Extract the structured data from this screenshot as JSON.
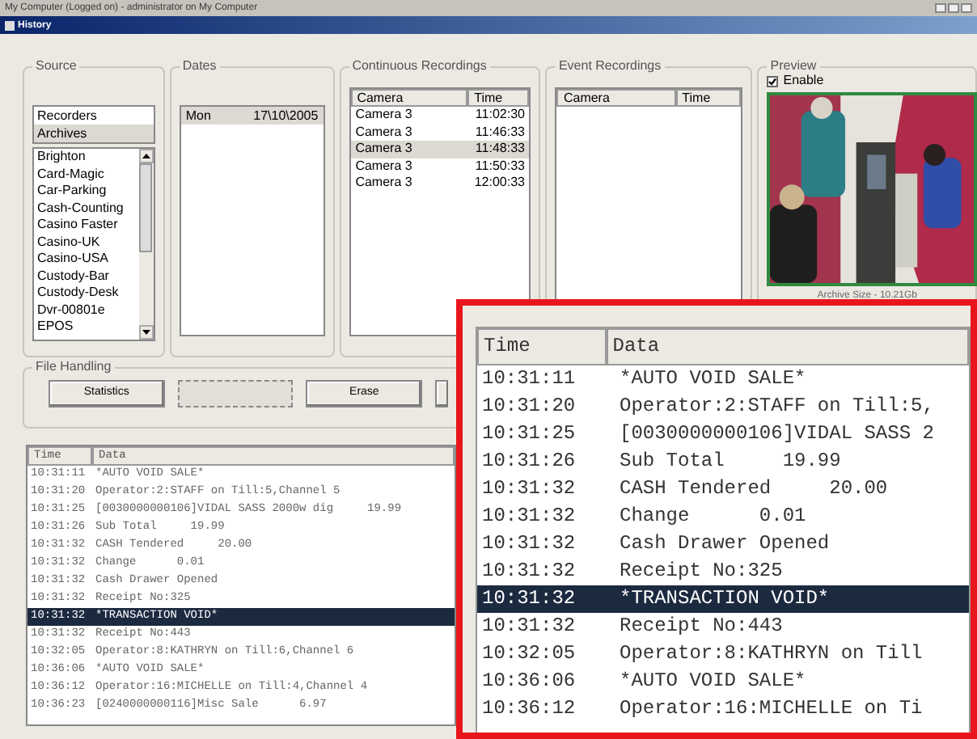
{
  "title_bar": {
    "title": "My Computer (Logged on) - administrator on My Computer"
  },
  "window": {
    "title": "History"
  },
  "source": {
    "label": "Source",
    "modes": [
      {
        "label": "Recorders",
        "selected": false
      },
      {
        "label": "Archives",
        "selected": true
      }
    ],
    "archives": [
      "Brighton",
      "Card-Magic",
      "Car-Parking",
      "Cash-Counting",
      "Casino Faster",
      "Casino-UK",
      "Casino-USA",
      "Custody-Bar",
      "Custody-Desk",
      "Dvr-00801e",
      "EPOS"
    ]
  },
  "dates": {
    "label": "Dates",
    "rows": [
      {
        "day": "Mon",
        "date": "17\\10\\2005",
        "selected": true
      }
    ]
  },
  "continuous": {
    "label": "Continuous Recordings",
    "columns": [
      "Camera",
      "Time"
    ],
    "rows": [
      {
        "camera": "Camera 3",
        "time": "11:02:30",
        "selected": false
      },
      {
        "camera": "Camera 3",
        "time": "11:46:33",
        "selected": false
      },
      {
        "camera": "Camera 3",
        "time": "11:48:33",
        "selected": true
      },
      {
        "camera": "Camera 3",
        "time": "11:50:33",
        "selected": false
      },
      {
        "camera": "Camera 3",
        "time": "12:00:33",
        "selected": false
      }
    ]
  },
  "event": {
    "label": "Event Recordings",
    "columns": [
      "Camera",
      "Time"
    ]
  },
  "preview": {
    "label": "Preview",
    "enable": {
      "label": "Enable",
      "checked": true
    },
    "archive_size": "Archive Size - 10.21Gb"
  },
  "file_handling": {
    "label": "File Handling",
    "buttons": [
      {
        "label": "Statistics",
        "disabled": false
      },
      {
        "disabled": true
      },
      {
        "label": "Erase",
        "disabled": false
      },
      {
        "disabled": false
      }
    ]
  },
  "log": {
    "columns": [
      "Time",
      "Data"
    ],
    "rows": [
      {
        "time": "10:31:11",
        "data": "*AUTO VOID SALE*",
        "selected": false
      },
      {
        "time": "10:31:20",
        "data": "Operator:2:STAFF on Till:5,Channel 5",
        "selected": false
      },
      {
        "time": "10:31:25",
        "data": "[0030000000106]VIDAL SASS 2000w dig     19.99",
        "selected": false
      },
      {
        "time": "10:31:26",
        "data": "Sub Total     19.99",
        "selected": false
      },
      {
        "time": "10:31:32",
        "data": "CASH Tendered     20.00",
        "selected": false
      },
      {
        "time": "10:31:32",
        "data": "Change      0.01",
        "selected": false
      },
      {
        "time": "10:31:32",
        "data": "Cash Drawer Opened",
        "selected": false
      },
      {
        "time": "10:31:32",
        "data": "Receipt No:325",
        "selected": false
      },
      {
        "time": "10:31:32",
        "data": "*TRANSACTION VOID*",
        "selected": true
      },
      {
        "time": "10:31:32",
        "data": "Receipt No:443",
        "selected": false
      },
      {
        "time": "10:32:05",
        "data": "Operator:8:KATHRYN on Till:6,Channel 6",
        "selected": false
      },
      {
        "time": "10:36:06",
        "data": "*AUTO VOID SALE*",
        "selected": false
      },
      {
        "time": "10:36:12",
        "data": "Operator:16:MICHELLE on Till:4,Channel 4",
        "selected": false
      },
      {
        "time": "10:36:23",
        "data": "[0240000000116]Misc Sale      6.97",
        "selected": false
      }
    ]
  },
  "zoom_inset": {
    "columns": [
      "Time",
      "Data"
    ],
    "rows": [
      {
        "time": "10:31:11",
        "data": "*AUTO VOID SALE*",
        "selected": false
      },
      {
        "time": "10:31:20",
        "data": "Operator:2:STAFF on Till:5,",
        "selected": false
      },
      {
        "time": "10:31:25",
        "data": "[0030000000106]VIDAL SASS 2",
        "selected": false
      },
      {
        "time": "10:31:26",
        "data": "Sub Total     19.99",
        "selected": false
      },
      {
        "time": "10:31:32",
        "data": "CASH Tendered     20.00",
        "selected": false
      },
      {
        "time": "10:31:32",
        "data": "Change      0.01",
        "selected": false
      },
      {
        "time": "10:31:32",
        "data": "Cash Drawer Opened",
        "selected": false
      },
      {
        "time": "10:31:32",
        "data": "Receipt No:325",
        "selected": false
      },
      {
        "time": "10:31:32",
        "data": "*TRANSACTION VOID*",
        "selected": true
      },
      {
        "time": "10:31:32",
        "data": "Receipt No:443",
        "selected": false
      },
      {
        "time": "10:32:05",
        "data": "Operator:8:KATHRYN on Till",
        "selected": false
      },
      {
        "time": "10:36:06",
        "data": "*AUTO VOID SALE*",
        "selected": false
      },
      {
        "time": "10:36:12",
        "data": "Operator:16:MICHELLE on Ti",
        "selected": false
      }
    ]
  }
}
